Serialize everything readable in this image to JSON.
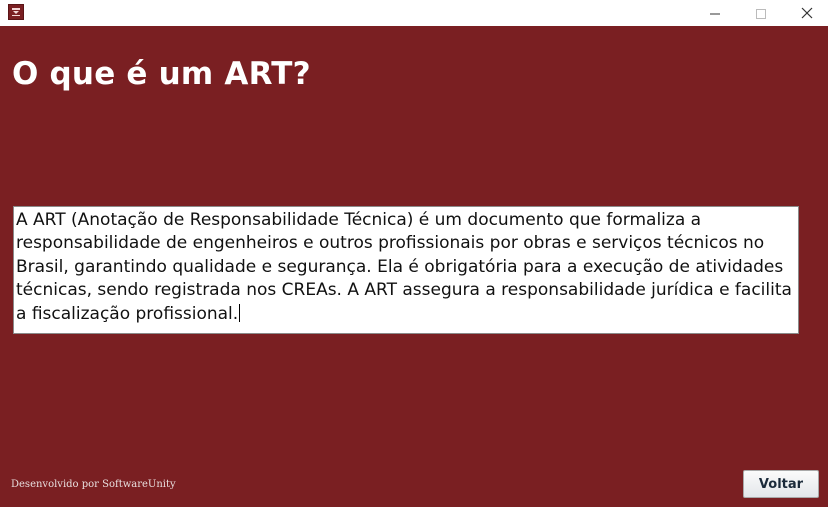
{
  "window": {
    "icon": "app-logo-icon",
    "controls": {
      "minimize_icon": "minimize-icon",
      "maximize_icon": "maximize-icon",
      "close_icon": "close-icon"
    }
  },
  "main": {
    "title": "O que é um ART?",
    "description": "A ART (Anotação de Responsabilidade Técnica) é um documento que formaliza a responsabilidade de engenheiros e outros profissionais por obras e serviços técnicos no Brasil, garantindo qualidade e segurança. Ela é obrigatória para a execução de atividades técnicas, sendo registrada nos CREAs. A ART assegura a responsabilidade jurídica e facilita a fiscalização profissional."
  },
  "footer": {
    "credit": "Desenvolvido por SoftwareUnity",
    "back_label": "Voltar"
  },
  "colors": {
    "background": "#7a1f22",
    "title_text": "#ffffff",
    "titlebar": "#ffffff"
  }
}
